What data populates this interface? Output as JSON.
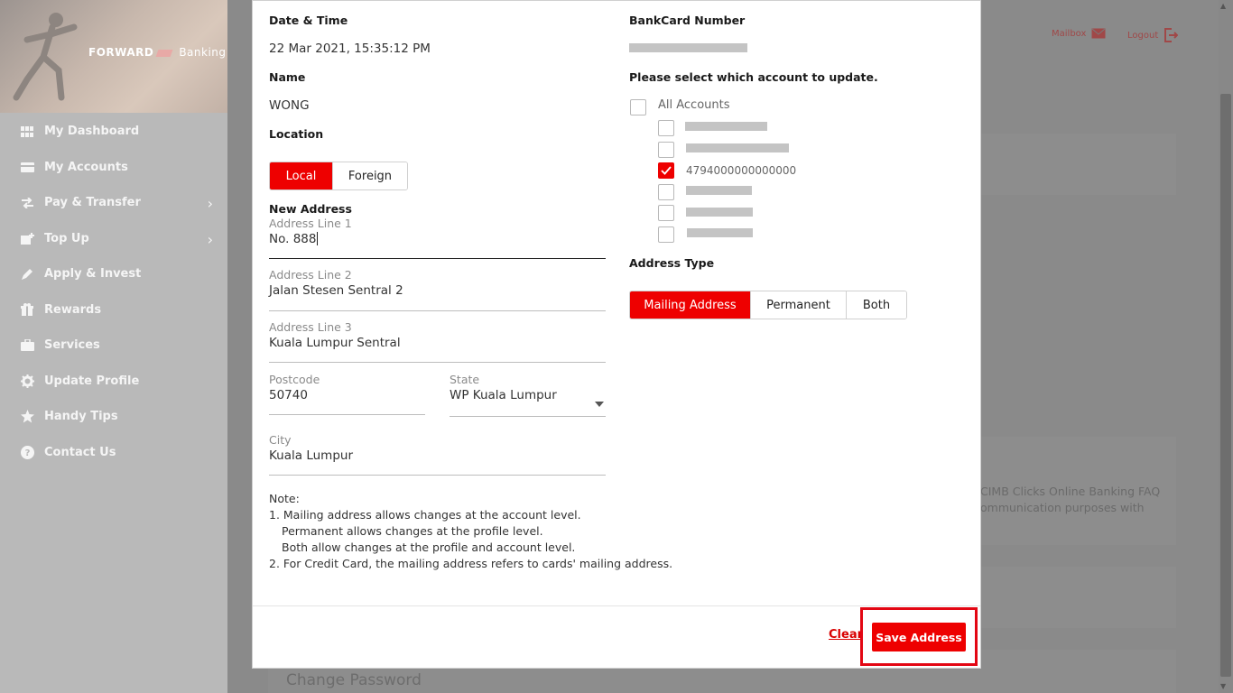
{
  "brand": {
    "name": "FORWARD",
    "suffix": "Banking"
  },
  "sidebar": {
    "items": [
      {
        "label": "My Dashboard",
        "icon": "dashboard-icon"
      },
      {
        "label": "My Accounts",
        "icon": "card-icon"
      },
      {
        "label": "Pay & Transfer",
        "icon": "transfer-icon",
        "has_submenu": true
      },
      {
        "label": "Top Up",
        "icon": "topup-icon",
        "has_submenu": true
      },
      {
        "label": "Apply & Invest",
        "icon": "pencil-icon"
      },
      {
        "label": "Rewards",
        "icon": "gift-icon"
      },
      {
        "label": "Services",
        "icon": "briefcase-icon"
      },
      {
        "label": "Update Profile",
        "icon": "gear-icon"
      },
      {
        "label": "Handy Tips",
        "icon": "star-icon"
      },
      {
        "label": "Contact Us",
        "icon": "help-icon"
      }
    ]
  },
  "header": {
    "mailbox_label": "Mailbox",
    "logout_label": "Logout"
  },
  "background": {
    "faq_line1": "CIMB Clicks Online Banking FAQ",
    "faq_line2": "ommunication purposes with",
    "change_password": "Change Password"
  },
  "modal": {
    "date_time_label": "Date & Time",
    "date_time_value": "22 Mar 2021, 15:35:12 PM",
    "name_label": "Name",
    "name_value": "WONG",
    "location_label": "Location",
    "location_options": [
      "Local",
      "Foreign"
    ],
    "location_selected": "Local",
    "new_address_label": "New Address",
    "fields": {
      "line1": {
        "label": "Address Line 1",
        "value": "No. 888"
      },
      "line2": {
        "label": "Address Line 2",
        "value": "Jalan Stesen Sentral 2"
      },
      "line3": {
        "label": "Address Line 3",
        "value": "Kuala Lumpur Sentral"
      },
      "postcode": {
        "label": "Postcode",
        "value": "50740"
      },
      "state": {
        "label": "State",
        "value": "WP Kuala Lumpur"
      },
      "city": {
        "label": "City",
        "value": "Kuala Lumpur"
      }
    },
    "bankcard_label": "BankCard Number",
    "select_account_label": "Please select which account to update.",
    "all_accounts_label": "All Accounts",
    "accounts": [
      {
        "number": "",
        "masked": true,
        "checked": false
      },
      {
        "number": "",
        "masked": true,
        "checked": false
      },
      {
        "number": "4794000000000000",
        "masked": false,
        "checked": true
      },
      {
        "number": "",
        "masked": true,
        "checked": false
      },
      {
        "number": "",
        "masked": true,
        "checked": false
      },
      {
        "number": "",
        "masked": true,
        "checked": false
      }
    ],
    "address_type_label": "Address Type",
    "address_type_options": [
      "Mailing Address",
      "Permanent",
      "Both"
    ],
    "address_type_selected": "Mailing Address",
    "note": {
      "title": "Note:",
      "line1": "1. Mailing address allows changes at the account level.",
      "line2": "Permanent allows changes at the profile level.",
      "line3": "Both allow changes at the profile and account level.",
      "line4": "2. For Credit Card, the mailing address refers to cards' mailing address."
    },
    "clear_label": "Clear",
    "save_label": "Save Address"
  },
  "colors": {
    "accent": "#ee0000",
    "highlight": "#e30613"
  }
}
